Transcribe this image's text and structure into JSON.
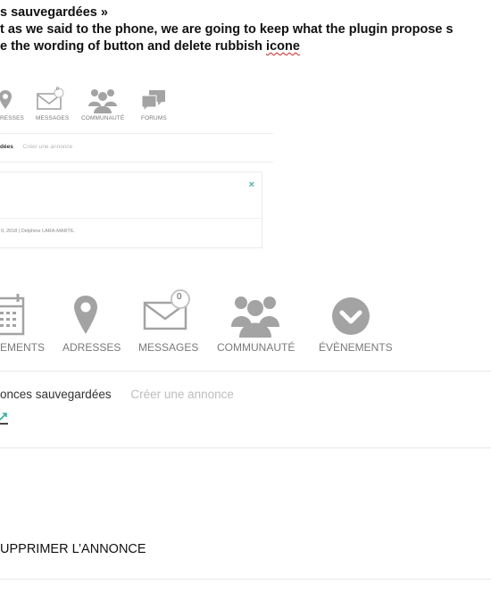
{
  "notes": {
    "line1": "s sauvegardées »",
    "line2": "t as we said to the phone, we are going to keep what the plugin propose s",
    "line3_before": "e the wording of button and delete rubbish ",
    "line3_word": "icone"
  },
  "small_nav": {
    "items": [
      {
        "label": "RESSES",
        "icon": "map-pin-icon"
      },
      {
        "label": "MESSAGES",
        "icon": "envelope-icon",
        "badge": "0"
      },
      {
        "label": "COMMUNAUTÉ",
        "icon": "users-icon"
      },
      {
        "label": "FORUMS",
        "icon": "chat-bubbles-icon"
      }
    ],
    "tabs": {
      "active": "dées",
      "create": "Créer une annonce"
    },
    "card": {
      "close": "×",
      "meta": "0, 2018 | Delphine LARA-MARTIL"
    }
  },
  "large_nav": {
    "items": [
      {
        "label": "EMENTS",
        "icon": "calendar-icon"
      },
      {
        "label": "ADRESSES",
        "icon": "map-pin-icon"
      },
      {
        "label": "MESSAGES",
        "icon": "envelope-icon",
        "badge": "0"
      },
      {
        "label": "COMMUNAUTÉ",
        "icon": "users-icon"
      },
      {
        "label": "ÉVÈNEMENTS",
        "icon": "chevron-circle-icon"
      }
    ],
    "tabs": {
      "active": "onces sauvegardées",
      "create": "Créer une annonce"
    },
    "share_icon": "external-link-icon",
    "delete_label": "UPPRIMER L’ANNONCE"
  },
  "colors": {
    "icon_gray": "#a3a3a3",
    "close_teal": "#3fb3a3",
    "share_teal": "#2bb1a0"
  }
}
